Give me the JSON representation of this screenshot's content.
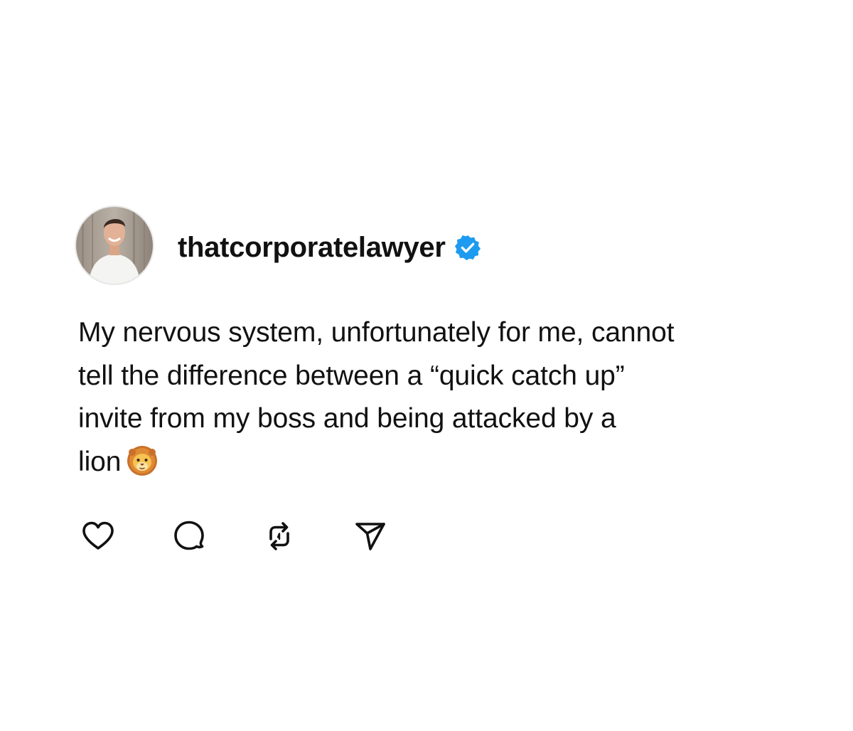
{
  "post": {
    "author": {
      "username": "thatcorporatelawyer",
      "verified": true,
      "avatar_icon": "profile-photo",
      "verified_icon": "verified-badge-icon"
    },
    "text_lines": [
      "My nervous system, unfortunately for me, cannot",
      "tell the difference between a “quick catch up”",
      "invite from my boss and being attacked by a",
      "lion"
    ],
    "emoji": "lion-face-emoji",
    "actions": [
      {
        "name": "like",
        "icon": "heart-icon"
      },
      {
        "name": "comment",
        "icon": "comment-bubble-icon"
      },
      {
        "name": "repost",
        "icon": "repost-icon"
      },
      {
        "name": "share",
        "icon": "send-icon"
      }
    ]
  },
  "colors": {
    "background": "#ffffff",
    "text": "#111111",
    "verified_blue": "#1D9BF0",
    "icon_stroke": "#111111"
  }
}
